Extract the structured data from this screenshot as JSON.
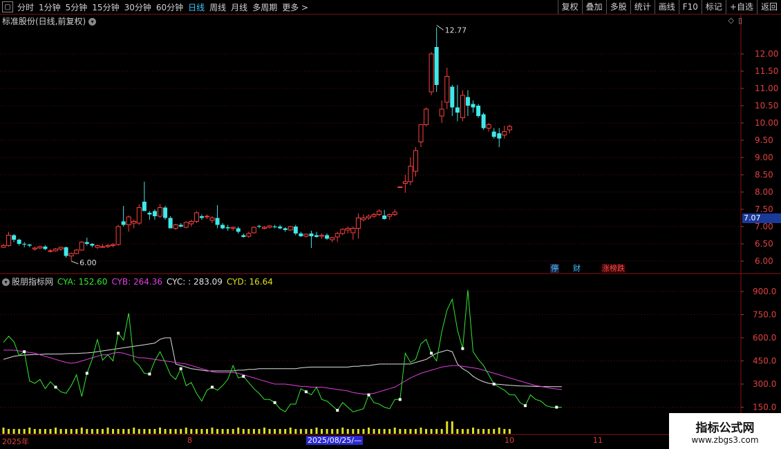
{
  "toolbar": {
    "periods": [
      "分时",
      "1分钟",
      "5分钟",
      "15分钟",
      "30分钟",
      "60分钟",
      "日线",
      "周线",
      "月线",
      "多周期",
      "更多"
    ],
    "active_period": "日线",
    "more_arrow": ">",
    "right_buttons": [
      "复权",
      "叠加",
      "多股",
      "统计",
      "画线",
      "F10",
      "标记",
      "+自选",
      "返回"
    ]
  },
  "main": {
    "title": "标准股份(日线,前复权)",
    "high_label": "12.77",
    "low_label": "6.00",
    "current_price": "7.07",
    "y_ticks": [
      "12.00",
      "11.50",
      "11.00",
      "10.50",
      "10.00",
      "9.50",
      "9.00",
      "8.50",
      "8.00",
      "7.50",
      "7.00",
      "6.50",
      "6.00"
    ],
    "events": [
      {
        "label": "停",
        "color": "#3cc8ff",
        "bg": "#224"
      },
      {
        "label": "财",
        "color": "#3cc8ff",
        "bg": "#000"
      },
      {
        "label": "涨榜跌",
        "color": "#ff5050",
        "bg": "#300"
      }
    ]
  },
  "indicator": {
    "name": "股朋指标网",
    "cya": "CYA: 152.60",
    "cyb": "CYB: 264.36",
    "cyc": "CYC: : 283.09",
    "cyd": "CYD: 16.64",
    "y_ticks": [
      "900.0",
      "750.0",
      "600.0",
      "450.0",
      "300.0",
      "150.0"
    ]
  },
  "xaxis": {
    "labels": [
      "2025年",
      "8",
      "10",
      "11"
    ],
    "current_date": "2025/08/25/—"
  },
  "watermark": {
    "line1": "指标公式网",
    "line2": "www.zbgs3.com"
  },
  "colors": {
    "up": "#ff4040",
    "down": "#40e8e8",
    "grid": "#5a1010",
    "cya": "#33e833",
    "cyb": "#e040e0",
    "cyc": "#e0e0e0",
    "cyd": "#e0e020"
  },
  "chart_data": {
    "type": "candlestick",
    "ohlc": [
      [
        6.4,
        6.5,
        6.38,
        6.45
      ],
      [
        6.45,
        6.85,
        6.42,
        6.75
      ],
      [
        6.75,
        6.78,
        6.55,
        6.62
      ],
      [
        6.62,
        6.65,
        6.45,
        6.5
      ],
      [
        6.5,
        6.55,
        6.4,
        6.48
      ],
      [
        6.48,
        6.5,
        6.4,
        6.45
      ],
      [
        6.35,
        6.42,
        6.3,
        6.38
      ],
      [
        6.38,
        6.45,
        6.35,
        6.42
      ],
      [
        6.42,
        6.46,
        6.32,
        6.35
      ],
      [
        6.3,
        6.35,
        6.25,
        6.3
      ],
      [
        6.3,
        6.38,
        6.27,
        6.35
      ],
      [
        6.35,
        6.42,
        6.3,
        6.4
      ],
      [
        6.4,
        6.42,
        6.1,
        6.15
      ],
      [
        6.15,
        6.25,
        6.0,
        6.22
      ],
      [
        6.22,
        6.35,
        6.2,
        6.32
      ],
      [
        6.32,
        6.58,
        6.3,
        6.55
      ],
      [
        6.55,
        6.68,
        6.45,
        6.5
      ],
      [
        6.5,
        6.52,
        6.4,
        6.45
      ],
      [
        6.4,
        6.48,
        6.35,
        6.45
      ],
      [
        6.42,
        6.5,
        6.4,
        6.42
      ],
      [
        6.42,
        6.5,
        6.38,
        6.45
      ],
      [
        6.45,
        6.52,
        6.4,
        6.48
      ],
      [
        6.48,
        7.05,
        6.45,
        7.0
      ],
      [
        7.15,
        7.6,
        7.0,
        7.05
      ],
      [
        7.05,
        7.32,
        6.85,
        7.28
      ],
      [
        7.1,
        7.2,
        6.95,
        7.15
      ],
      [
        7.1,
        7.65,
        7.05,
        7.55
      ],
      [
        7.72,
        8.3,
        7.45,
        7.45
      ],
      [
        7.4,
        7.45,
        7.2,
        7.35
      ],
      [
        7.45,
        7.5,
        7.2,
        7.3
      ],
      [
        7.3,
        7.65,
        7.25,
        7.55
      ],
      [
        7.55,
        7.6,
        7.2,
        7.25
      ],
      [
        7.25,
        7.3,
        6.95,
        6.95
      ],
      [
        6.95,
        7.08,
        6.9,
        7.05
      ],
      [
        7.05,
        7.1,
        6.98,
        7.0
      ],
      [
        6.98,
        7.15,
        6.95,
        7.12
      ],
      [
        7.08,
        7.2,
        7.0,
        7.15
      ],
      [
        7.15,
        7.45,
        7.1,
        7.4
      ],
      [
        7.3,
        7.35,
        7.2,
        7.25
      ],
      [
        7.28,
        7.35,
        7.22,
        7.3
      ],
      [
        7.18,
        7.3,
        7.1,
        7.25
      ],
      [
        7.25,
        7.62,
        6.95,
        7.05
      ],
      [
        7.05,
        7.1,
        6.92,
        6.95
      ],
      [
        6.98,
        7.05,
        6.88,
        6.95
      ],
      [
        6.95,
        7.0,
        6.88,
        6.98
      ],
      [
        6.95,
        7.0,
        6.8,
        6.85
      ],
      [
        6.75,
        6.8,
        6.68,
        6.7
      ],
      [
        6.72,
        6.85,
        6.68,
        6.8
      ],
      [
        6.82,
        7.0,
        6.8,
        6.98
      ],
      [
        7.02,
        7.05,
        6.95,
        7.0
      ],
      [
        6.95,
        7.02,
        6.92,
        6.98
      ],
      [
        6.98,
        7.05,
        6.95,
        7.02
      ],
      [
        7.0,
        7.05,
        6.95,
        6.98
      ],
      [
        7.0,
        7.05,
        6.92,
        6.95
      ],
      [
        6.95,
        6.98,
        6.85,
        6.9
      ],
      [
        6.9,
        7.02,
        6.88,
        7.0
      ],
      [
        7.0,
        7.05,
        6.75,
        6.8
      ],
      [
        6.8,
        6.85,
        6.7,
        6.72
      ],
      [
        6.72,
        6.8,
        6.68,
        6.78
      ],
      [
        6.8,
        6.88,
        6.38,
        6.72
      ],
      [
        6.75,
        6.85,
        6.68,
        6.7
      ],
      [
        6.72,
        6.8,
        6.65,
        6.75
      ],
      [
        6.75,
        6.8,
        6.62,
        6.65
      ],
      [
        6.62,
        6.7,
        6.55,
        6.68
      ],
      [
        6.7,
        6.85,
        6.55,
        6.8
      ],
      [
        6.8,
        6.95,
        6.75,
        6.92
      ],
      [
        6.9,
        7.0,
        6.8,
        6.95
      ],
      [
        6.82,
        7.0,
        6.62,
        6.95
      ],
      [
        6.95,
        7.38,
        6.65,
        7.25
      ],
      [
        7.2,
        7.35,
        7.15,
        7.25
      ],
      [
        7.25,
        7.35,
        7.2,
        7.3
      ],
      [
        7.3,
        7.4,
        7.25,
        7.35
      ],
      [
        7.35,
        7.5,
        7.3,
        7.45
      ],
      [
        7.32,
        7.48,
        7.2,
        7.22
      ],
      [
        7.3,
        7.38,
        7.2,
        7.35
      ],
      [
        7.35,
        7.5,
        7.3,
        7.42
      ],
      [
        8.15,
        8.15,
        8.15,
        8.15
      ],
      [
        8.25,
        8.5,
        7.98,
        8.3
      ],
      [
        8.3,
        9.0,
        8.2,
        8.75
      ],
      [
        8.6,
        9.3,
        8.45,
        9.2
      ],
      [
        9.45,
        9.95,
        9.3,
        9.95
      ],
      [
        9.95,
        10.45,
        9.9,
        10.4
      ],
      [
        10.9,
        12.05,
        10.8,
        12.0
      ],
      [
        12.2,
        12.77,
        10.9,
        11.1
      ],
      [
        10.2,
        10.65,
        10.0,
        10.4
      ],
      [
        10.6,
        11.6,
        10.4,
        11.35
      ],
      [
        11.05,
        11.1,
        10.2,
        10.45
      ],
      [
        10.45,
        11.1,
        10.05,
        10.3
      ],
      [
        10.15,
        10.95,
        10.05,
        10.8
      ],
      [
        10.75,
        10.95,
        10.2,
        10.5
      ],
      [
        10.55,
        10.65,
        10.3,
        10.45
      ],
      [
        10.5,
        10.55,
        10.15,
        10.2
      ],
      [
        10.25,
        10.3,
        9.8,
        9.85
      ],
      [
        9.85,
        10.0,
        9.75,
        9.95
      ],
      [
        9.75,
        9.85,
        9.55,
        9.6
      ],
      [
        9.7,
        9.85,
        9.3,
        9.55
      ],
      [
        9.65,
        9.92,
        9.55,
        9.75
      ],
      [
        9.8,
        9.95,
        9.7,
        9.9
      ]
    ],
    "ylim": [
      5.75,
      12.5
    ],
    "indicator": {
      "CYA": [
        570,
        610,
        575,
        485,
        510,
        320,
        305,
        330,
        270,
        315,
        280,
        250,
        240,
        290,
        360,
        220,
        370,
        460,
        590,
        455,
        490,
        450,
        630,
        585,
        760,
        450,
        420,
        370,
        365,
        450,
        510,
        440,
        360,
        330,
        400,
        290,
        310,
        240,
        190,
        260,
        280,
        260,
        290,
        330,
        420,
        340,
        350,
        310,
        270,
        240,
        200,
        200,
        180,
        140,
        120,
        170,
        170,
        270,
        250,
        230,
        280,
        200,
        190,
        160,
        130,
        180,
        150,
        120,
        130,
        140,
        230,
        180,
        170,
        150,
        140,
        200,
        200,
        500,
        440,
        460,
        560,
        590,
        500,
        450,
        640,
        780,
        850,
        650,
        530,
        910,
        510,
        460,
        420,
        360,
        300,
        280,
        260,
        230,
        230,
        180,
        160,
        230,
        200,
        190,
        160,
        150,
        150,
        150
      ],
      "CYB": [
        520,
        520,
        520,
        515,
        510,
        505,
        500,
        490,
        480,
        470,
        460,
        450,
        440,
        435,
        440,
        450,
        460,
        470,
        480,
        490,
        490,
        500,
        505,
        500,
        490,
        480,
        470,
        470,
        465,
        460,
        455,
        450,
        445,
        440,
        435,
        430,
        420,
        410,
        400,
        390,
        380,
        375,
        375,
        375,
        375,
        370,
        360,
        350,
        340,
        330,
        320,
        310,
        300,
        300,
        300,
        295,
        290,
        285,
        285,
        280,
        280,
        280,
        275,
        270,
        265,
        260,
        255,
        245,
        240,
        235,
        235,
        240,
        250,
        260,
        270,
        280,
        300,
        320,
        340,
        355,
        370,
        380,
        390,
        400,
        410,
        415,
        420,
        420,
        415,
        410,
        405,
        400,
        390,
        380,
        370,
        360,
        350,
        340,
        330,
        320,
        310,
        300,
        290,
        285,
        278,
        272,
        268,
        264
      ],
      "CYC": [
        460,
        470,
        480,
        485,
        488,
        490,
        492,
        492,
        495,
        495,
        495,
        495,
        497,
        498,
        498,
        500,
        502,
        505,
        510,
        515,
        520,
        525,
        530,
        535,
        540,
        545,
        550,
        555,
        560,
        565,
        590,
        600,
        600,
        430,
        420,
        410,
        400,
        395,
        390,
        385,
        385,
        385,
        385,
        385,
        385,
        390,
        390,
        395,
        395,
        400,
        400,
        400,
        400,
        400,
        400,
        400,
        400,
        405,
        408,
        410,
        410,
        410,
        410,
        410,
        410,
        410,
        410,
        415,
        415,
        420,
        420,
        425,
        430,
        430,
        430,
        430,
        430,
        430,
        430,
        440,
        450,
        460,
        480,
        500,
        510,
        520,
        510,
        430,
        400,
        380,
        350,
        330,
        315,
        305,
        300,
        298,
        295,
        292,
        290,
        288,
        287,
        286,
        285,
        284,
        284,
        283,
        283,
        283
      ]
    }
  }
}
